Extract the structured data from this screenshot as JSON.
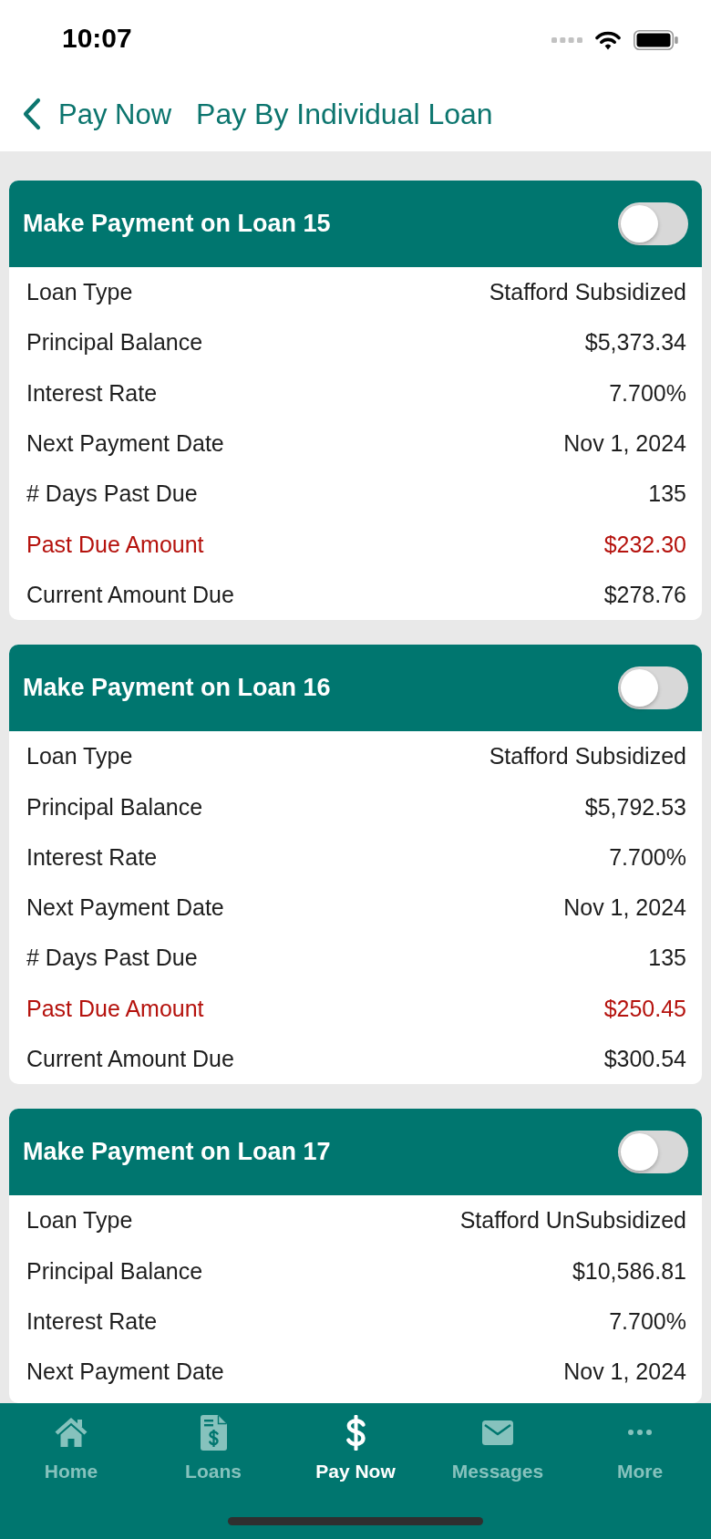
{
  "status_bar": {
    "time": "10:07"
  },
  "nav": {
    "back_label": "Pay Now",
    "title": "Pay By Individual Loan"
  },
  "loans": [
    {
      "title": "Make Payment on Loan 15",
      "on": false,
      "rows": [
        {
          "label": "Loan Type",
          "value": "Stafford Subsidized",
          "alert": false
        },
        {
          "label": "Principal Balance",
          "value": "$5,373.34",
          "alert": false
        },
        {
          "label": "Interest Rate",
          "value": "7.700%",
          "alert": false
        },
        {
          "label": "Next Payment Date",
          "value": "Nov 1, 2024",
          "alert": false
        },
        {
          "label": "# Days Past Due",
          "value": "135",
          "alert": false
        },
        {
          "label": "Past Due Amount",
          "value": "$232.30",
          "alert": true
        },
        {
          "label": "Current Amount Due",
          "value": "$278.76",
          "alert": false
        }
      ]
    },
    {
      "title": "Make Payment on Loan 16",
      "on": false,
      "rows": [
        {
          "label": "Loan Type",
          "value": "Stafford Subsidized",
          "alert": false
        },
        {
          "label": "Principal Balance",
          "value": "$5,792.53",
          "alert": false
        },
        {
          "label": "Interest Rate",
          "value": "7.700%",
          "alert": false
        },
        {
          "label": "Next Payment Date",
          "value": "Nov 1, 2024",
          "alert": false
        },
        {
          "label": "# Days Past Due",
          "value": "135",
          "alert": false
        },
        {
          "label": "Past Due Amount",
          "value": "$250.45",
          "alert": true
        },
        {
          "label": "Current Amount Due",
          "value": "$300.54",
          "alert": false
        }
      ]
    },
    {
      "title": "Make Payment on Loan 17",
      "on": false,
      "rows": [
        {
          "label": "Loan Type",
          "value": "Stafford UnSubsidized",
          "alert": false
        },
        {
          "label": "Principal Balance",
          "value": "$10,586.81",
          "alert": false
        },
        {
          "label": "Interest Rate",
          "value": "7.700%",
          "alert": false
        },
        {
          "label": "Next Payment Date",
          "value": "Nov 1, 2024",
          "alert": false
        }
      ]
    }
  ],
  "tab_bar": [
    {
      "label": "Home",
      "kind": "home",
      "selected": false
    },
    {
      "label": "Loans",
      "kind": "loans",
      "selected": false
    },
    {
      "label": "Pay Now",
      "kind": "pay",
      "selected": true
    },
    {
      "label": "Messages",
      "kind": "messages",
      "selected": false
    },
    {
      "label": "More",
      "kind": "more",
      "selected": false
    }
  ]
}
